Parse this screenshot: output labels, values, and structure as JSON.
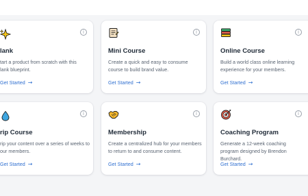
{
  "cards": [
    {
      "title": "lank",
      "description": "tart a product from scratch with this\nlank blueprint.",
      "cta": "Get Started",
      "icon": "sparkle-icon"
    },
    {
      "title": "Mini Course",
      "description": "Create a quick and easy to consume course to build brand value.",
      "cta": "Get Started",
      "icon": "document-icon"
    },
    {
      "title": "Online Course",
      "description": "Build a world class online learning experience for your members.",
      "cta": "Get Started",
      "icon": "books-icon"
    },
    {
      "title": "rip Course",
      "description": "rip your content over a series of weeks to\nour members.",
      "cta": "Get Started",
      "icon": "drop-icon"
    },
    {
      "title": "Membership",
      "description": "Create a centralized hub for your members to return to and consume content.",
      "cta": "Get Started",
      "icon": "handshake-icon"
    },
    {
      "title": "Coaching Program",
      "description": "Generate a 12-week coaching program designed by Brendon Burchard.",
      "cta": "Get Started",
      "icon": "target-icon"
    }
  ],
  "colors": {
    "accent": "#2f6fd0",
    "title": "#1f2a37",
    "description": "#5a6472",
    "background": "#f4f5f7"
  }
}
